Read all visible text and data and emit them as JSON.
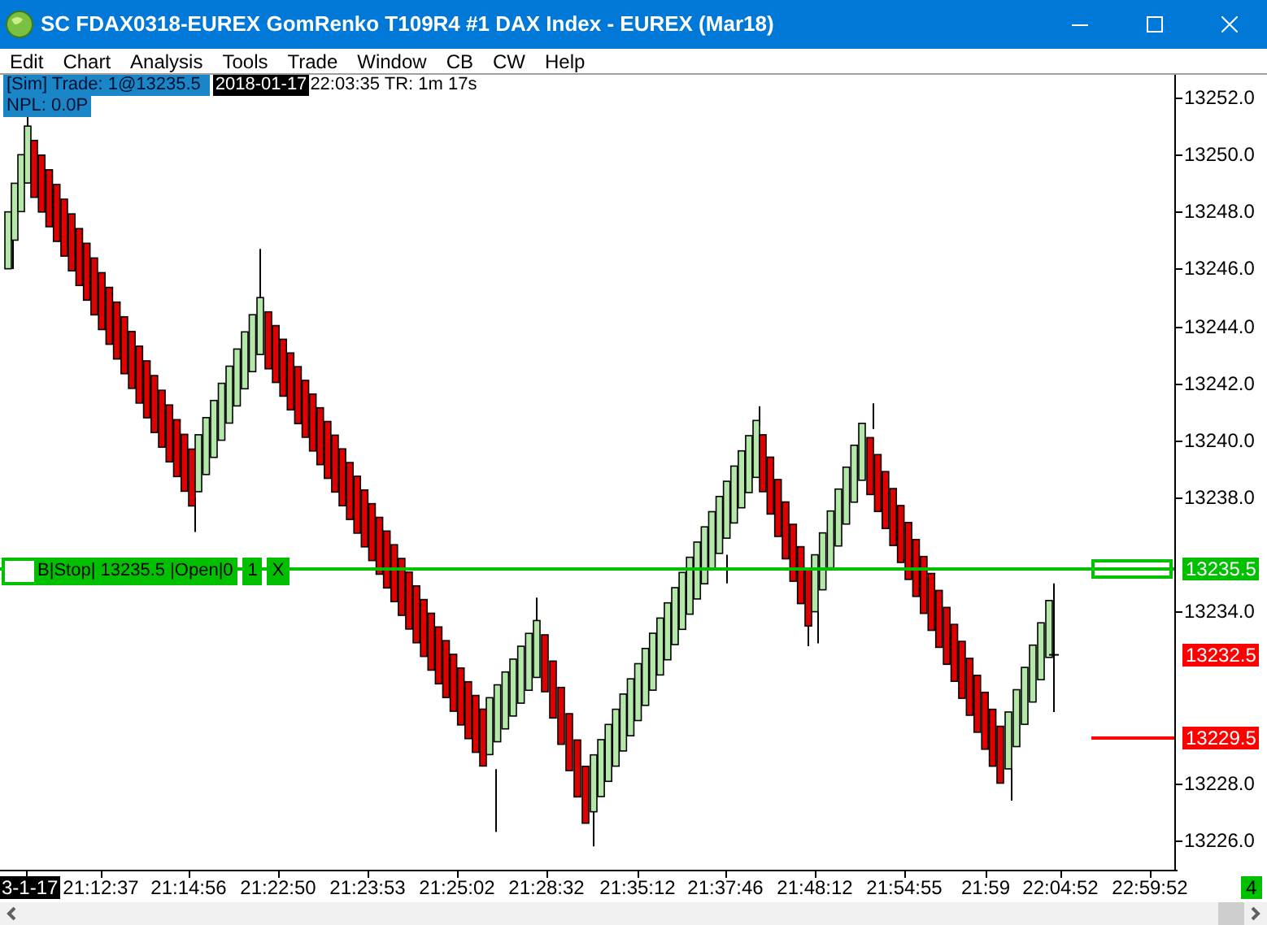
{
  "window": {
    "title": "SC FDAX0318-EUREX  GomRenko T109R4  #1  DAX Index - EUREX (Mar18)"
  },
  "menu": [
    "Edit",
    "Chart",
    "Analysis",
    "Tools",
    "Trade",
    "Window",
    "CB",
    "CW",
    "Help"
  ],
  "info": {
    "trade": "[Sim]  Trade: 1@13235.5",
    "date": "2018-01-17",
    "time": "22:03:35 TR: 1m 17s",
    "npl": "NPL: 0.0P"
  },
  "order_line": {
    "label": "B|Stop| 13235.5 |Open|0",
    "quantity": "1",
    "cancel": "X"
  },
  "y_axis": [
    "13252.0",
    "13250.0",
    "13248.0",
    "13246.0",
    "13244.0",
    "13242.0",
    "13240.0",
    "13238.0",
    "13234.0",
    "13228.0",
    "13226.0"
  ],
  "price_markers": [
    {
      "text": "13235.5",
      "color": "#00c000"
    },
    {
      "text": "13232.5",
      "color": "#ff0000"
    },
    {
      "text": "13229.5",
      "color": "#ff0000"
    }
  ],
  "x_axis": [
    {
      "text": "3-1-17",
      "selected": true
    },
    {
      "text": "21:12:37",
      "selected": false
    },
    {
      "text": "21:14:56",
      "selected": false
    },
    {
      "text": "21:22:50",
      "selected": false
    },
    {
      "text": "21:23:53",
      "selected": false
    },
    {
      "text": "21:25:02",
      "selected": false
    },
    {
      "text": "21:28:32",
      "selected": false
    },
    {
      "text": "21:35:12",
      "selected": false
    },
    {
      "text": "21:37:46",
      "selected": false
    },
    {
      "text": "21:48:12",
      "selected": false
    },
    {
      "text": "21:54:55",
      "selected": false
    },
    {
      "text": "21:59",
      "selected": false
    },
    {
      "text": "22:04:52",
      "selected": false
    },
    {
      "text": "22:59:52",
      "selected": false
    }
  ],
  "corner_badge": "4"
}
